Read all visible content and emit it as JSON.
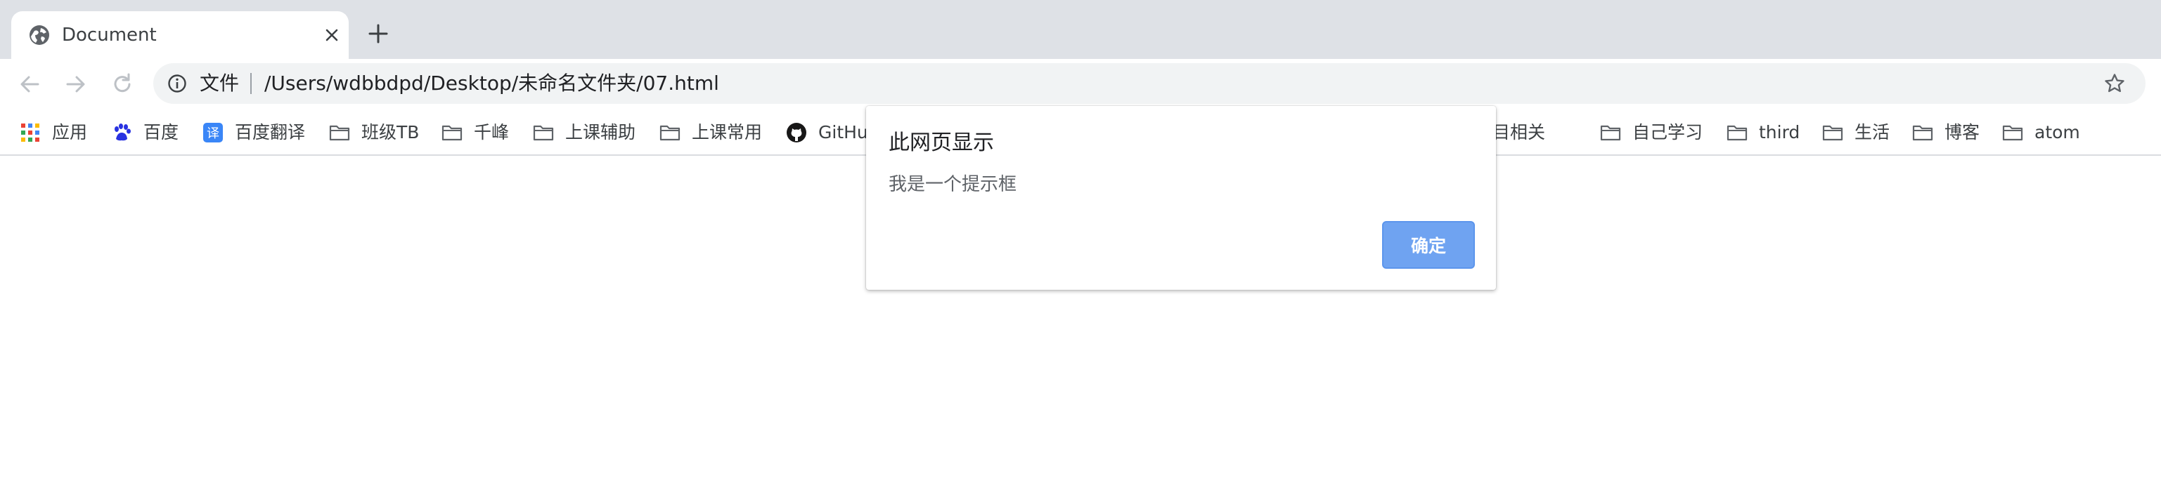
{
  "tab": {
    "title": "Document",
    "favicon": "globe-icon",
    "close_icon": "close-icon"
  },
  "new_tab_icon": "plus-icon",
  "toolbar": {
    "back_icon": "arrow-left-icon",
    "forward_icon": "arrow-right-icon",
    "reload_icon": "reload-icon",
    "site_info_icon": "info-icon",
    "site_label": "文件",
    "url": "/Users/wdbbdpd/Desktop/未命名文件夹/07.html",
    "bookmark_star_icon": "star-icon"
  },
  "bookmarks": [
    {
      "label": "应用",
      "icon": "apps-grid-icon"
    },
    {
      "label": "百度",
      "icon": "baidu-paw-icon"
    },
    {
      "label": "百度翻译",
      "icon": "translate-icon"
    },
    {
      "label": "班级TB",
      "icon": "folder-icon"
    },
    {
      "label": "千峰",
      "icon": "folder-icon"
    },
    {
      "label": "上课辅助",
      "icon": "folder-icon"
    },
    {
      "label": "上课常用",
      "icon": "folder-icon"
    },
    {
      "label": "GitHub",
      "icon": "github-icon"
    },
    {
      "label": "项目相关",
      "icon": "folder-icon"
    },
    {
      "label": "自己学习",
      "icon": "folder-icon"
    },
    {
      "label": "third",
      "icon": "folder-icon"
    },
    {
      "label": "生活",
      "icon": "folder-icon"
    },
    {
      "label": "博客",
      "icon": "folder-icon"
    },
    {
      "label": "atom",
      "icon": "folder-icon"
    }
  ],
  "dialog": {
    "title": "此网页显示",
    "message": "我是一个提示框",
    "ok_label": "确定",
    "ok_color": "#6fa3f1"
  },
  "colors": {
    "tabstrip_bg": "#dee1e6",
    "omnibox_bg": "#f1f3f4",
    "folder": "#5f6368"
  }
}
